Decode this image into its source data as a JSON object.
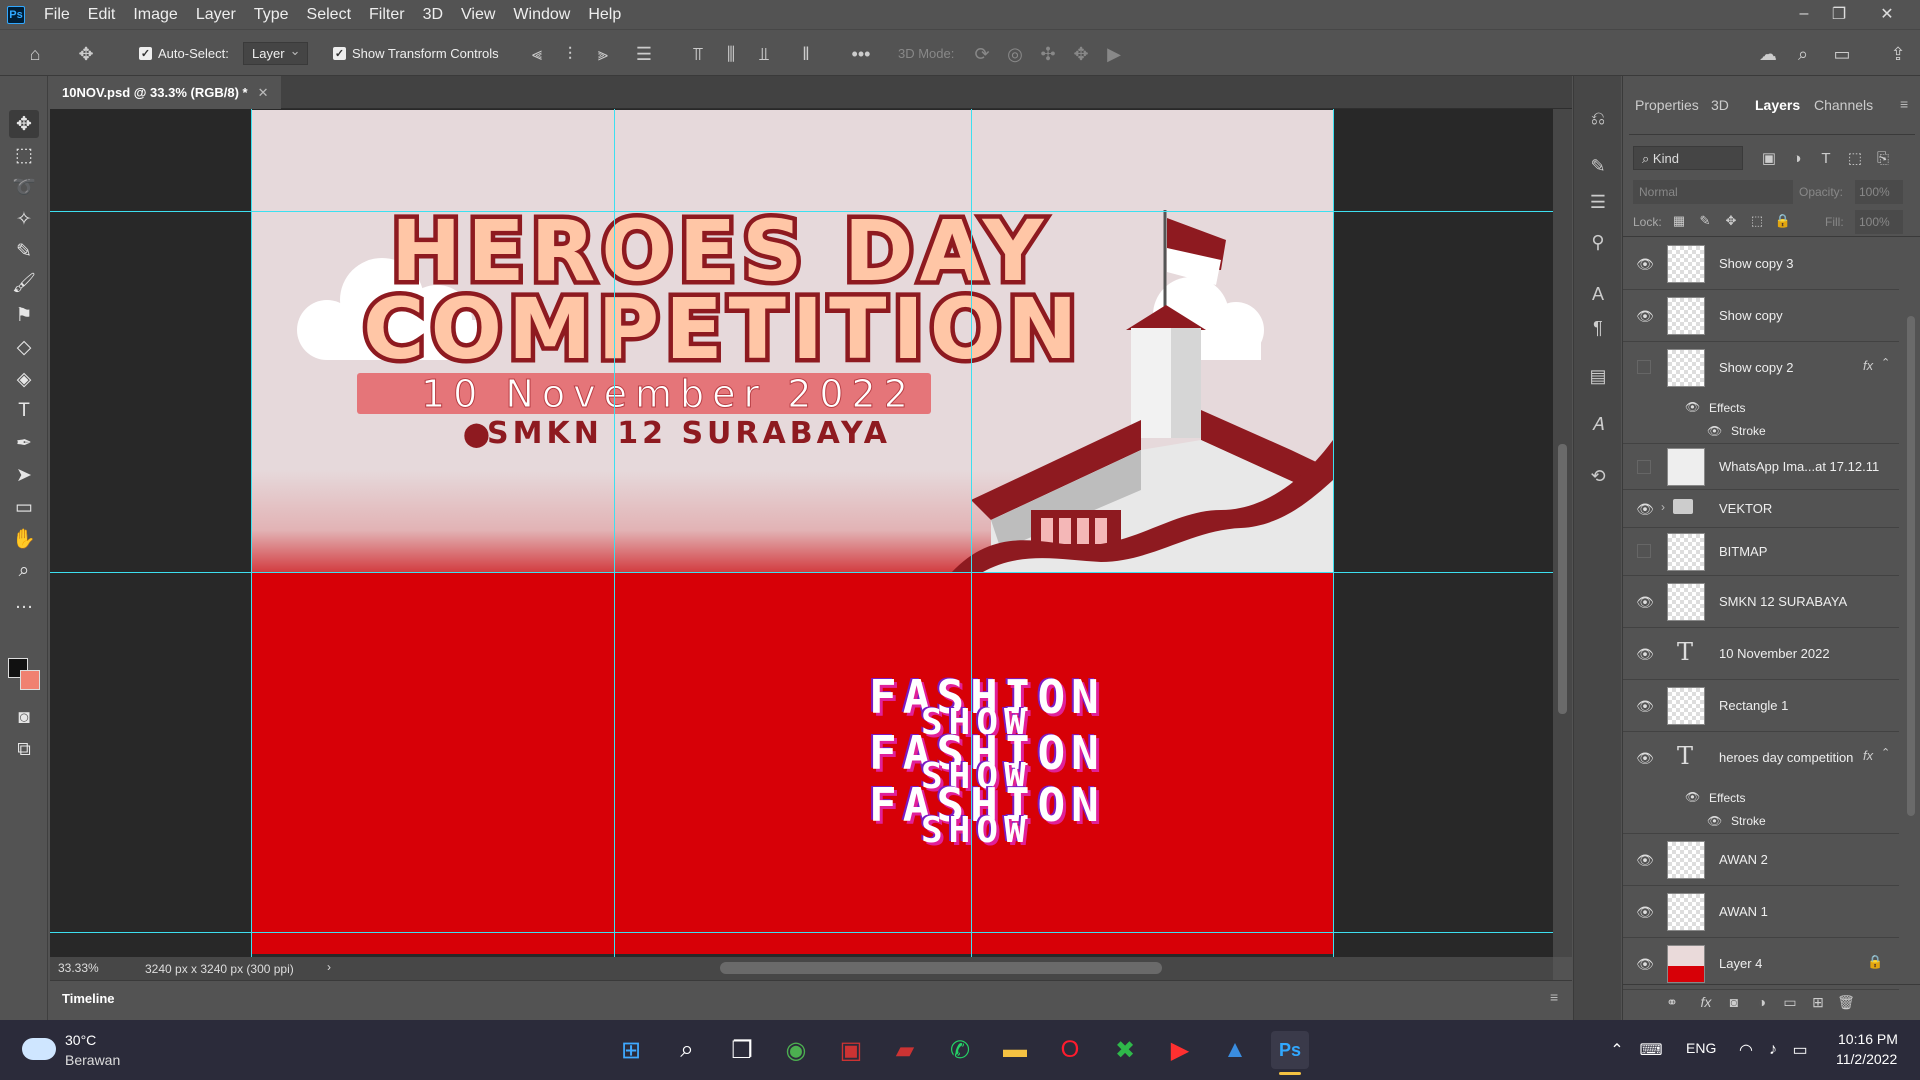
{
  "app": {
    "logo": "Ps",
    "menu": [
      "File",
      "Edit",
      "Image",
      "Layer",
      "Type",
      "Select",
      "Filter",
      "3D",
      "View",
      "Window",
      "Help"
    ]
  },
  "options": {
    "auto_select_label": "Auto-Select:",
    "auto_select_value": "Layer",
    "show_transform_label": "Show Transform Controls",
    "mode_label": "3D Mode:"
  },
  "document": {
    "tab_title": "10NOV.psd @ 33.3% (RGB/8) *",
    "zoom": "33.33%",
    "doc_size": "3240 px x 3240 px (300 ppi)"
  },
  "artwork": {
    "title_line1": "HEROES DAY",
    "title_line2": "COMPETITION",
    "date": "10 November 2022",
    "place": "SMKN 12 SURABAYA",
    "fashion_word1": "FASHION",
    "fashion_word2": "SHOW",
    "colors": {
      "sky": "#e6d9db",
      "red": "#d70007",
      "maroon": "#8e1a20",
      "peach": "#ffc6a6",
      "banner": "#e57579"
    }
  },
  "timeline": {
    "label": "Timeline"
  },
  "panel": {
    "tabs": [
      "Properties",
      "3D",
      "Layers",
      "Channels"
    ],
    "active_tab": "Layers",
    "kind_filter": "Kind",
    "blend_mode": "Normal",
    "opacity_label": "Opacity:",
    "opacity_value": "100%",
    "lock_label": "Lock:",
    "fill_label": "Fill:",
    "fill_value": "100%",
    "effects_label": "Effects",
    "stroke_label": "Stroke",
    "layers": [
      {
        "name": "Show copy 3",
        "visible": true
      },
      {
        "name": "Show copy",
        "visible": true
      },
      {
        "name": "Show copy 2",
        "visible": false,
        "fx": "fx"
      },
      {
        "name": "WhatsApp Ima...at 17.12.11",
        "visible": false
      },
      {
        "name": "VEKTOR",
        "visible": true
      },
      {
        "name": "BITMAP",
        "visible": false
      },
      {
        "name": "SMKN 12 SURABAYA",
        "visible": true
      },
      {
        "name": "10 November 2022",
        "visible": true
      },
      {
        "name": "Rectangle 1",
        "visible": true
      },
      {
        "name": "heroes day competition",
        "visible": true,
        "fx": "fx"
      },
      {
        "name": "AWAN 2",
        "visible": true
      },
      {
        "name": "AWAN 1",
        "visible": true
      },
      {
        "name": "Layer 4",
        "visible": true
      }
    ]
  },
  "taskbar": {
    "temperature": "30°C",
    "weather": "Berawan",
    "language": "ENG",
    "time": "10:16 PM",
    "date": "11/2/2022"
  }
}
